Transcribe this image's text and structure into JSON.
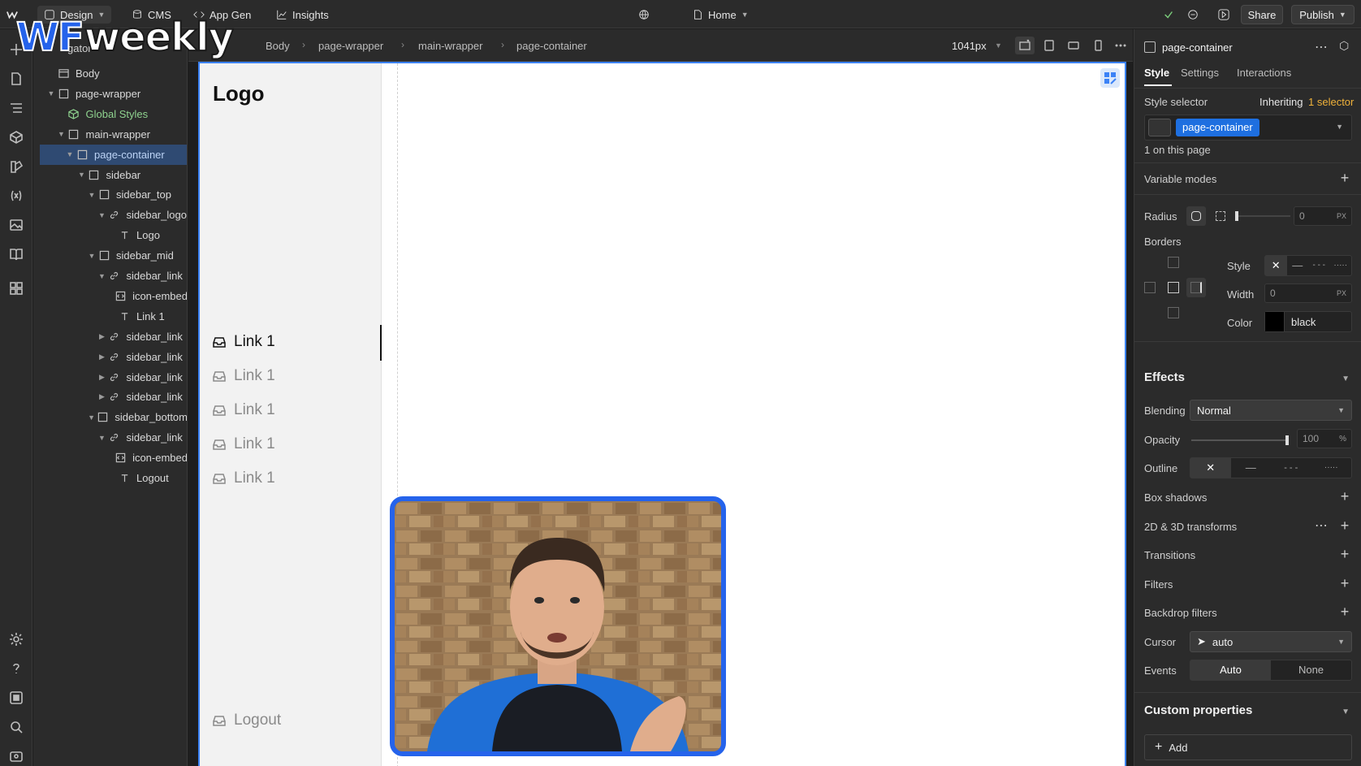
{
  "topbar": {
    "design_label": "Design",
    "cms_label": "CMS",
    "appgen_label": "App Gen",
    "insights_label": "Insights",
    "page_label": "Home",
    "share_label": "Share",
    "publish_label": "Publish"
  },
  "watermark": {
    "wf": "WF",
    "weekly": "weekly"
  },
  "navigator": {
    "title": "gator",
    "tree": [
      {
        "label": "Body"
      },
      {
        "label": "page-wrapper"
      },
      {
        "label": "Global Styles"
      },
      {
        "label": "main-wrapper"
      },
      {
        "label": "page-container"
      },
      {
        "label": "sidebar"
      },
      {
        "label": "sidebar_top"
      },
      {
        "label": "sidebar_logo"
      },
      {
        "label": "Logo"
      },
      {
        "label": "sidebar_mid"
      },
      {
        "label": "sidebar_link"
      },
      {
        "label": "icon-embed"
      },
      {
        "label": "Link 1"
      },
      {
        "label": "sidebar_link"
      },
      {
        "label": "sidebar_link"
      },
      {
        "label": "sidebar_link"
      },
      {
        "label": "sidebar_link"
      },
      {
        "label": "sidebar_bottom"
      },
      {
        "label": "sidebar_link"
      },
      {
        "label": "icon-embed"
      },
      {
        "label": "Logout"
      }
    ]
  },
  "breadcrumb": {
    "items": [
      "Body",
      "page-wrapper",
      "main-wrapper",
      "page-container"
    ],
    "width_label": "1041px"
  },
  "canvas": {
    "logo": "Logo",
    "links": [
      "Link 1",
      "Link 1",
      "Link 1",
      "Link 1",
      "Link 1"
    ],
    "logout": "Logout"
  },
  "panel": {
    "element_name": "page-container",
    "tabs": [
      "Style",
      "Settings",
      "Interactions"
    ],
    "style_selector_label": "Style selector",
    "inheriting_prefix": "Inheriting",
    "inheriting_link": "1 selector",
    "selector_chip": "page-container",
    "on_page": "1 on this page",
    "variable_modes": "Variable modes",
    "radius_label": "Radius",
    "radius_value": "0",
    "radius_unit": "PX",
    "borders_label": "Borders",
    "border_style_label": "Style",
    "border_width_label": "Width",
    "border_width_value": "0",
    "border_width_unit": "PX",
    "border_color_label": "Color",
    "border_color_value": "black",
    "effects_label": "Effects",
    "blending_label": "Blending",
    "blending_value": "Normal",
    "opacity_label": "Opacity",
    "opacity_value": "100",
    "opacity_unit": "%",
    "opacity_fraction": 1.0,
    "outline_label": "Outline",
    "box_shadows": "Box shadows",
    "transforms": "2D & 3D transforms",
    "transitions": "Transitions",
    "filters": "Filters",
    "backdrop_filters": "Backdrop filters",
    "cursor_label": "Cursor",
    "cursor_value": "auto",
    "events_label": "Events",
    "events_auto": "Auto",
    "events_none": "None",
    "custom_properties": "Custom properties",
    "add_label": "Add"
  },
  "colors": {
    "accent": "#2563eb",
    "selected_row": "#2f4a72",
    "global_styles": "#8fd38f",
    "panel_bg": "#2b2b2b"
  }
}
